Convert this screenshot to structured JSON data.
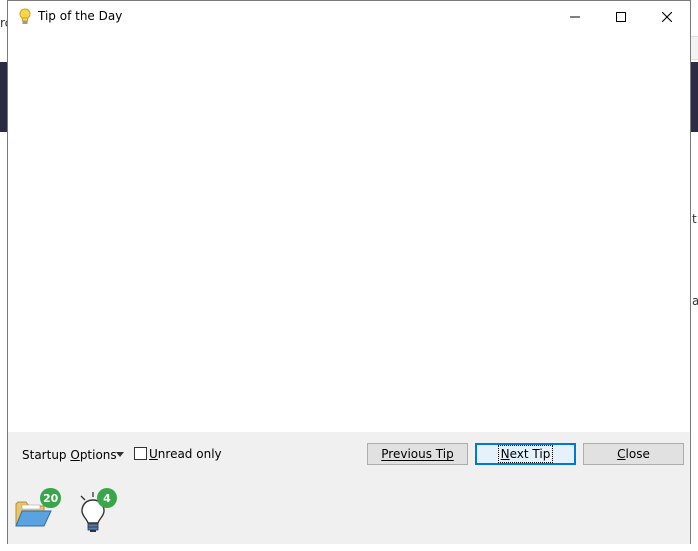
{
  "window": {
    "title": "Tip of the Day",
    "controls": {
      "minimize": "minimize",
      "maximize": "maximize",
      "close": "close"
    }
  },
  "footer": {
    "startup_options_pre": "Startup ",
    "startup_options_mnemonic": "O",
    "startup_options_post": "ptions",
    "unread_mnemonic": "U",
    "unread_post": "nread only",
    "unread_checked": false,
    "previous_pre": "Previous Tip",
    "next_mnemonic": "N",
    "next_post": "ext Tip",
    "close_mnemonic": "C",
    "close_post": "lose"
  },
  "status": {
    "projects_count": "20",
    "tips_count": "4"
  },
  "background": {
    "left_char": "rc",
    "right_char_1": "t",
    "right_char_2": "a"
  },
  "colors": {
    "badge": "#3aa64a",
    "default_button_border": "#0078d7",
    "panel": "#f0f0f0"
  },
  "icons": [
    "lightbulb-icon",
    "minimize-icon",
    "maximize-icon",
    "close-icon",
    "dropdown-arrow-icon",
    "folder-icon"
  ]
}
